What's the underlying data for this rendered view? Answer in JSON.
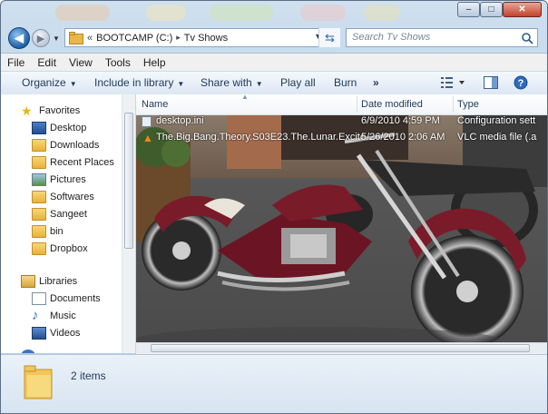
{
  "window": {
    "controls": {
      "minimize": "–",
      "maximize": "□",
      "close": "✕"
    }
  },
  "address": {
    "overflow": "«",
    "drive": "BOOTCAMP (C:)",
    "separator": "▸",
    "folder": "Tv Shows",
    "dropdown": "▾",
    "refresh": "⇆"
  },
  "search": {
    "placeholder": "Search Tv Shows"
  },
  "menu": {
    "items": [
      "File",
      "Edit",
      "View",
      "Tools",
      "Help"
    ]
  },
  "toolbar": {
    "organize": "Organize",
    "include": "Include in library",
    "share": "Share with",
    "play": "Play all",
    "burn": "Burn",
    "more": "»"
  },
  "nav": {
    "favorites": {
      "title": "Favorites",
      "items": [
        "Desktop",
        "Downloads",
        "Recent Places",
        "Pictures",
        "Softwares",
        "Sangeet",
        "bin",
        "Dropbox"
      ]
    },
    "libraries": {
      "title": "Libraries",
      "items": [
        "Documents",
        "Music",
        "Videos"
      ]
    }
  },
  "columns": {
    "name": "Name",
    "date": "Date modified",
    "type": "Type"
  },
  "files": [
    {
      "name": "desktop.ini",
      "date": "6/9/2010 4:59 PM",
      "type": "Configuration sett"
    },
    {
      "name": "The.Big.Bang.Theory.S03E23.The.Lunar.Excite...",
      "date": "5/26/2010 2:06 AM",
      "type": "VLC media file (.a"
    }
  ],
  "status": {
    "count": "2 items"
  },
  "colors": {
    "accent": "#1e395b",
    "frame": "#b9d1e7",
    "bike": "#7a1b2a"
  }
}
